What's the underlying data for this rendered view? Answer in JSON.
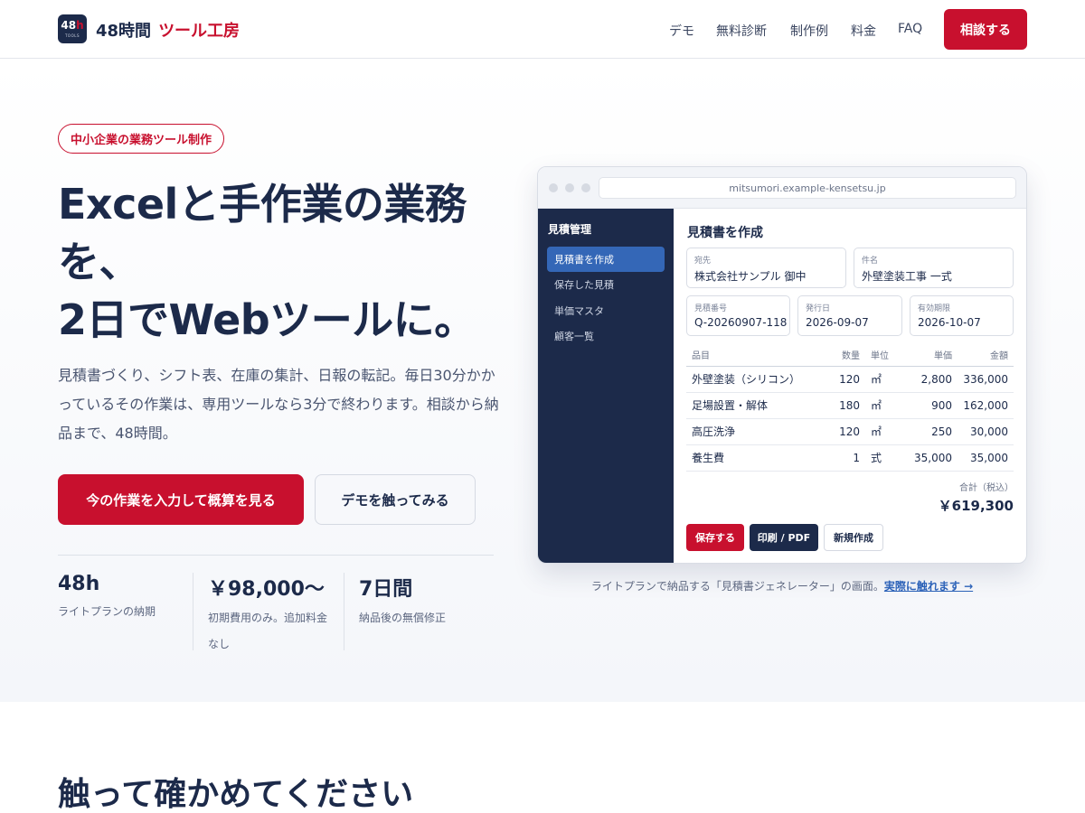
{
  "header": {
    "logo_num": "48",
    "logo_h": "h",
    "logo_sub": "TOOLS",
    "brand_main": "48時間",
    "brand_accent": "ツール工房",
    "nav": [
      "デモ",
      "無料診断",
      "制作例",
      "料金",
      "FAQ"
    ],
    "cta": "相談する"
  },
  "hero": {
    "pill": "中小企業の業務ツール制作",
    "headline": [
      "Excelと手作業の業務",
      "を、",
      "2日でWebツールに。"
    ],
    "lead": "見積書づくり、シフト表、在庫の集計、日報の転記。毎日30分かかっているその作業は、専用ツールなら3分で終わります。相談から納品まで、48時間。",
    "primary_button": "今の作業を入力して概算を見る",
    "secondary_button": "デモを触ってみる",
    "stats": [
      {
        "value": "48h",
        "desc": "ライトプランの納期"
      },
      {
        "value": "￥98,000〜",
        "desc": "初期費用のみ。追加料金なし"
      },
      {
        "value": "7日間",
        "desc": "納品後の無償修正"
      }
    ]
  },
  "mock": {
    "url": "mitsumori.example-kensetsu.jp",
    "sidebar_title": "見積管理",
    "sidebar_items": [
      "見積書を作成",
      "保存した見積",
      "単価マスタ",
      "顧客一覧"
    ],
    "title": "見積書を作成",
    "fields": [
      {
        "label": "宛先",
        "value": "株式会社サンプル 御中"
      },
      {
        "label": "件名",
        "value": "外壁塗装工事 一式"
      },
      {
        "label": "見積番号",
        "value": "Q-20260907-118"
      },
      {
        "label": "発行日",
        "value": "2026-09-07"
      },
      {
        "label": "有効期限",
        "value": "2026-10-07"
      }
    ],
    "columns": [
      "品目",
      "数量",
      "単位",
      "単価",
      "金額"
    ],
    "rows": [
      [
        "外壁塗装（シリコン）",
        "120",
        "㎡",
        "2,800",
        "336,000"
      ],
      [
        "足場設置・解体",
        "180",
        "㎡",
        "900",
        "162,000"
      ],
      [
        "高圧洗浄",
        "120",
        "㎡",
        "250",
        "30,000"
      ],
      [
        "養生費",
        "1",
        "式",
        "35,000",
        "35,000"
      ]
    ],
    "total_label": "合計（税込）",
    "total_value": "￥619,300",
    "buttons": [
      "保存する",
      "印刷 / PDF",
      "新規作成"
    ]
  },
  "caption": {
    "text": "ライトプランで納品する「見積書ジェネレーター」の画面。",
    "link": "実際に触れます →"
  },
  "section2": {
    "title": "触って確かめてください"
  },
  "colors": {
    "brand_red": "#c8102e",
    "navy": "#1c2a4a",
    "active_blue": "#3467b7",
    "link_blue": "#2c62b8"
  }
}
